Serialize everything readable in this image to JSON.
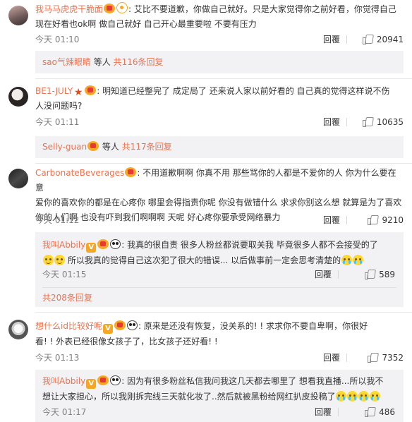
{
  "comments": [
    {
      "user": "我马马虎虎干脆面",
      "text_line1": ": 艾比不要道歉，你做自己就好。只是大家觉得你之前好看，你觉得自己",
      "text_line2": "现在好看也ok啊 做自己就好 自己开心最重要啦 不要有压力",
      "time": "今天 01:10",
      "reply": "回覆",
      "likes": "20941",
      "sub_user": "sao气辣眼睛",
      "sub_mid": " 等人 ",
      "sub_count": "共116条回复"
    },
    {
      "user": "BE1-JULY",
      "text_line1": ": 明知道已经整完了 成定局了 还来说人家以前好看的 自己真的觉得这样说不伤",
      "text_line2": "人没问题吗?",
      "time": "今天 01:11",
      "reply": "回覆",
      "likes": "10635",
      "sub_user": "Selly-guan",
      "sub_mid": " 等人 ",
      "sub_count": "共117条回复"
    },
    {
      "user": "CarbonateBeverages",
      "text_line1": ": 不用道歉啊啊 你真不用 那些骂你的人都是不爱你的人 你为什么要在意",
      "text_line2": "爱你的喜欢你的都是在心疼你 哪里会得指责你呢 你没有做错什么 求求你别这么想 就算是为了喜欢",
      "text_line3": "你的人们啊 也没有吓到我们啊啊啊 天呢 好心疼你要承受网络暴力",
      "time": "今天 01:12",
      "reply": "回覆",
      "likes": "9210",
      "sub_reply": {
        "user": "我叫Abbily",
        "text_line1": ": 我真的很自责 很多人粉丝都说要取关我 毕竟很多人都不会接受的了",
        "text_line2": "所以我真的觉得自己这次犯了很大的错误...    以后做事前一定会思考清楚的",
        "time": "今天 01:15",
        "reply": "回覆",
        "likes": "589"
      },
      "more_replies": "共208条回复"
    },
    {
      "user": "想什么id比较好呢",
      "text_line1": ": 原来是还没有恢复，没关系的! ! 求求你不要自卑啊，你很好",
      "text_line2": "看! ! 外表已经很像女孩子了，比女孩子还好看! !",
      "time": "今天 01:13",
      "reply": "回覆",
      "likes": "7352",
      "sub_reply": {
        "user": "我叫Abbily",
        "text_line1": ": 因为有很多粉丝私信我问我这几天都去哪里了 想看我直播...所以我不",
        "text_line2": "想让大家担心，所以我刚拆完线三天就化妆了..然后就被黑粉给网红扒皮投稿了",
        "time": "今天 01:17",
        "reply": "回覆",
        "likes": "486"
      }
    }
  ]
}
